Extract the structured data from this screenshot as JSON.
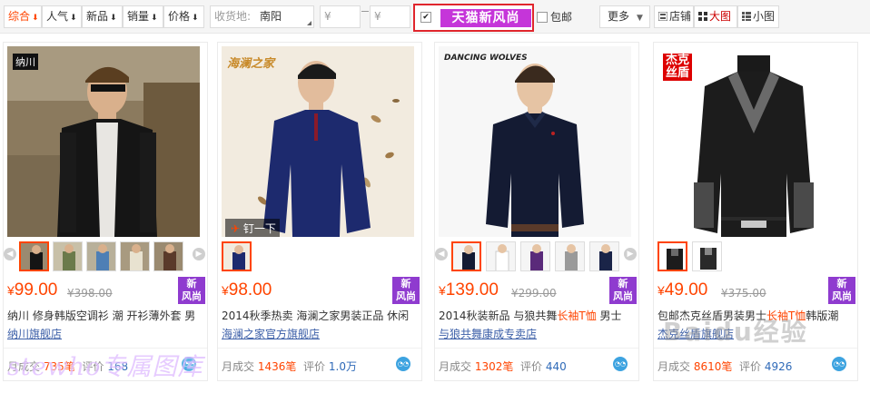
{
  "toolbar": {
    "sort_options": [
      {
        "label": "综合",
        "active": true
      },
      {
        "label": "人气",
        "active": false
      },
      {
        "label": "新品",
        "active": false
      },
      {
        "label": "销量",
        "active": false
      },
      {
        "label": "价格",
        "active": false
      }
    ],
    "location_label": "收货地:",
    "location_value": "南阳",
    "price_min_placeholder": "¥",
    "price_max_placeholder": "¥",
    "tmall_label": "天猫新风尚",
    "tmall_checked": true,
    "free_shipping_label": "包邮",
    "free_shipping_checked": false,
    "more_label": "更多",
    "views": [
      {
        "label": "店铺",
        "active": false
      },
      {
        "label": "大图",
        "active": true
      },
      {
        "label": "小图",
        "active": false
      }
    ]
  },
  "products": [
    {
      "brand_logo": "纳川",
      "currency": "¥",
      "price": "99.00",
      "original_price": "¥398.00",
      "badge": [
        "新",
        "风尚"
      ],
      "title": "纳川 修身韩版空调衫 潮 开衫薄外套 男",
      "title_highlight": "",
      "shop": "纳川旗舰店",
      "sales_label": "月成交",
      "sales_value": "735笔",
      "reviews_label": "评价",
      "reviews_value": "168",
      "thumb_count": 5,
      "pin_label": ""
    },
    {
      "brand_logo": "海澜之家",
      "currency": "¥",
      "price": "98.00",
      "original_price": "",
      "badge": [
        "新",
        "风尚"
      ],
      "title": "2014秋季热卖 海澜之家男装正品 休闲",
      "title_highlight": "",
      "shop": "海澜之家官方旗舰店",
      "sales_label": "月成交",
      "sales_value": "1436笔",
      "reviews_label": "评价",
      "reviews_value": "1.0万",
      "thumb_count": 1,
      "pin_label": "钉一下"
    },
    {
      "brand_logo": "DANCING WOLVES",
      "currency": "¥",
      "price": "139.00",
      "original_price": "¥299.00",
      "badge": [
        "新",
        "风尚"
      ],
      "title": "2014秋装新品 与狼共舞长袖T恤 男士",
      "title_highlight": "长袖T恤",
      "shop": "与狼共舞康成专卖店",
      "sales_label": "月成交",
      "sales_value": "1302笔",
      "reviews_label": "评价",
      "reviews_value": "440",
      "thumb_count": 6,
      "pin_label": ""
    },
    {
      "brand_logo": "杰克丝盾",
      "currency": "¥",
      "price": "49.00",
      "original_price": "¥375.00",
      "badge": [
        "新",
        "风尚"
      ],
      "title": "包邮杰克丝盾男装男士长袖T恤韩版潮",
      "title_highlight": "长袖T恤",
      "shop": "杰克丝盾旗舰店",
      "sales_label": "月成交",
      "sales_value": "8610笔",
      "reviews_label": "评价",
      "reviews_value": "4926",
      "thumb_count": 2,
      "pin_label": ""
    }
  ],
  "watermark_left": "stewho专属图库",
  "watermark_right": "Baidu经验",
  "colors": {
    "accent": "#ff4400",
    "tmall_purple": "#c535d9",
    "badge_purple": "#8f3bcf",
    "highlight_border": "#e0262d",
    "link_blue": "#3c5fa8"
  }
}
